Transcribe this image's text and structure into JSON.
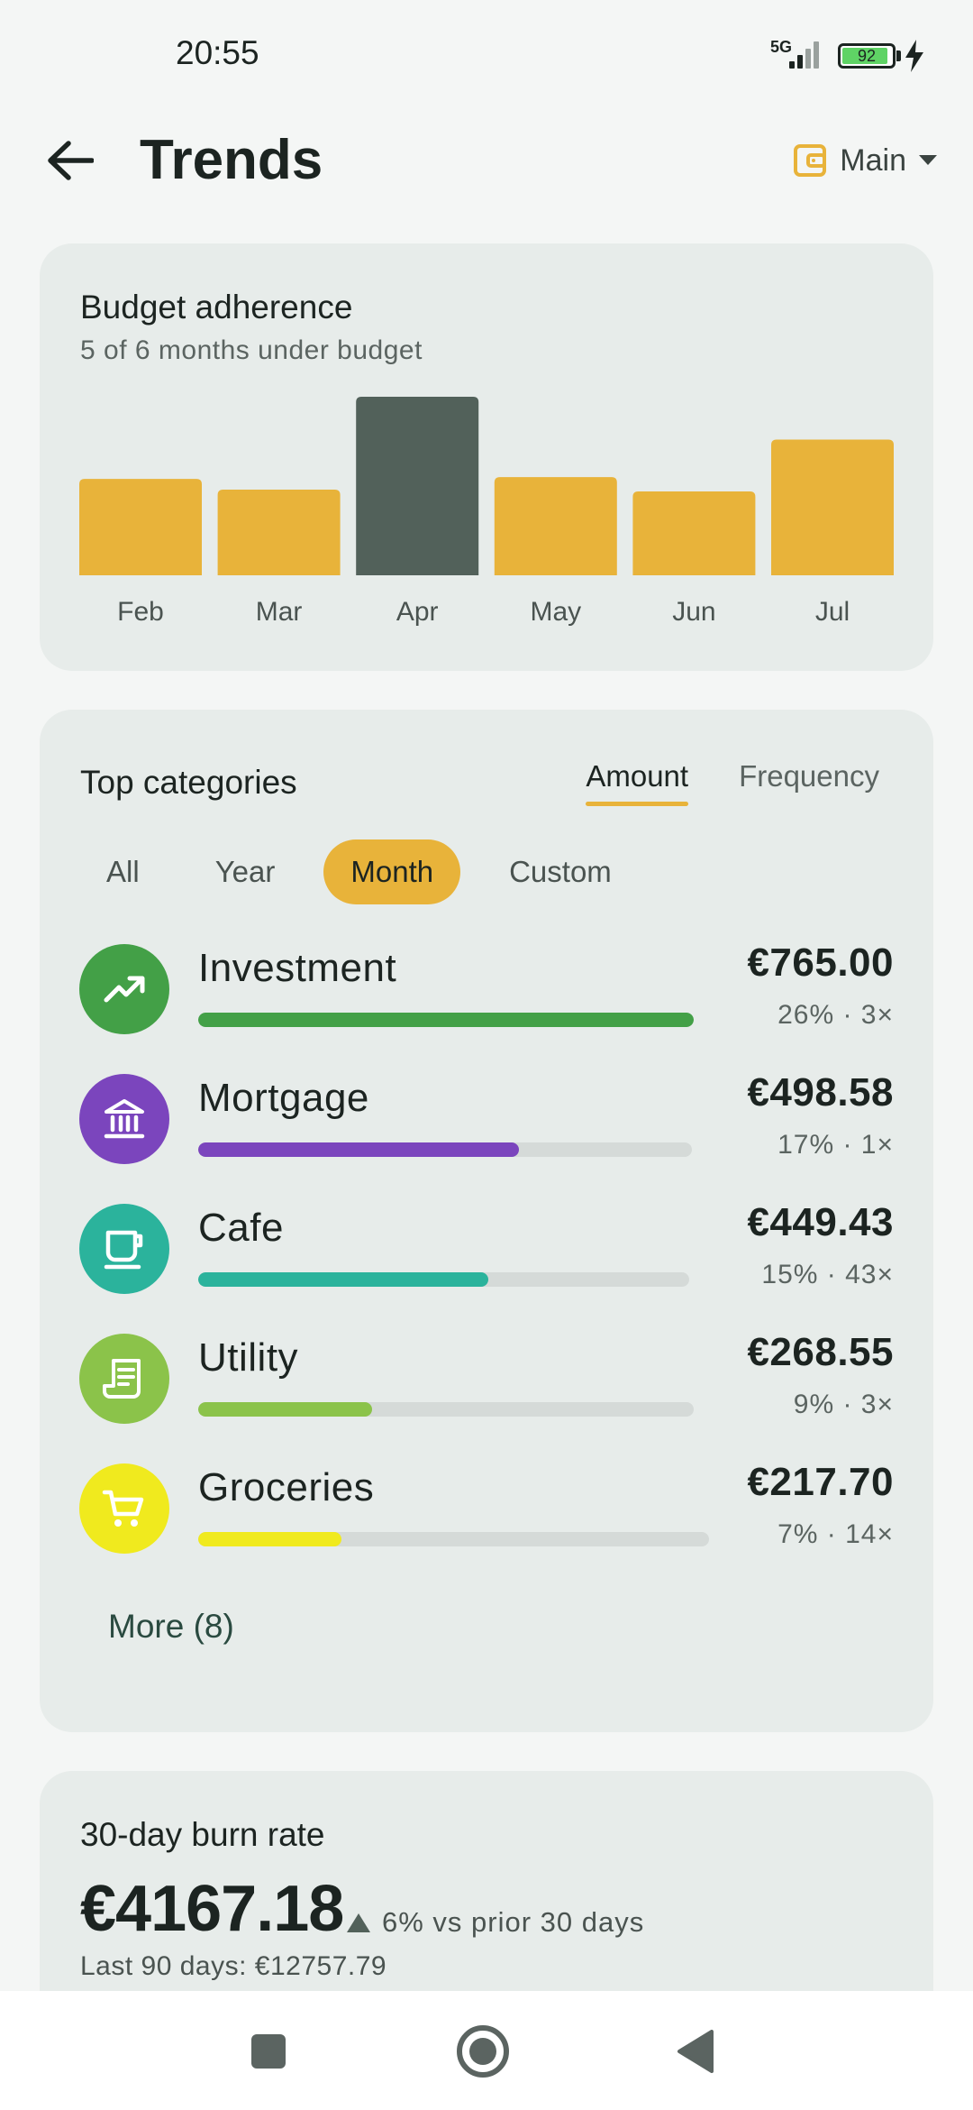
{
  "status_bar": {
    "time": "20:55",
    "network": "5G",
    "battery": "92",
    "battery_level": 0.92
  },
  "header": {
    "title": "Trends",
    "back_icon": "arrow-left-icon",
    "account_label": "Main",
    "account_icon": "wallet-icon",
    "dropdown_icon": "caret-down-icon"
  },
  "budget": {
    "title": "Budget adherence",
    "subtitle": "5 of 6 months under budget",
    "chart_data": {
      "type": "bar",
      "categories": [
        "Feb",
        "Mar",
        "Apr",
        "May",
        "Jun",
        "Jul"
      ],
      "values": [
        54,
        48,
        100,
        55,
        47,
        76
      ],
      "over_budget": [
        false,
        false,
        true,
        false,
        false,
        false
      ],
      "colors": {
        "under": "#e8b33a",
        "over": "#52615a"
      }
    }
  },
  "categories": {
    "title": "Top categories",
    "tabs": [
      "Amount",
      "Frequency"
    ],
    "active_tab": 0,
    "filters": [
      "All",
      "Year",
      "Month",
      "Custom"
    ],
    "active_filter": 2,
    "items": [
      {
        "name": "Investment",
        "amount": "€765.00",
        "meta": "26% · 3×",
        "share": 1.0,
        "color": "#43a047",
        "icon": "trending-up-icon"
      },
      {
        "name": "Mortgage",
        "amount": "€498.58",
        "meta": "17% · 1×",
        "share": 0.65,
        "color": "#7b45bd",
        "icon": "bank-icon"
      },
      {
        "name": "Cafe",
        "amount": "€449.43",
        "meta": "15% · 43×",
        "share": 0.59,
        "color": "#2bb39c",
        "icon": "coffee-cup-icon"
      },
      {
        "name": "Utility",
        "amount": "€268.55",
        "meta": "9% · 3×",
        "share": 0.35,
        "color": "#8bc34a",
        "icon": "receipt-icon"
      },
      {
        "name": "Groceries",
        "amount": "€217.70",
        "meta": "7% · 14×",
        "share": 0.28,
        "color": "#f0ea1e",
        "icon": "shopping-cart-icon"
      }
    ],
    "more_label": "More (8)"
  },
  "burn": {
    "title": "30-day burn rate",
    "amount": "€4167.18",
    "delta": "6% vs prior 30 days",
    "delta_icon": "triangle-up-icon",
    "last_90": "Last 90 days: €12757.79"
  },
  "nav": {
    "recents_icon": "square-icon",
    "home_icon": "circle-home-icon",
    "back_icon": "triangle-back-icon"
  }
}
